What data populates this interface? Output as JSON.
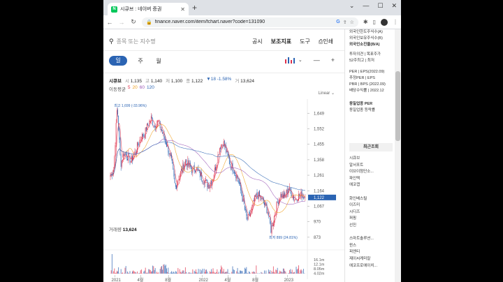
{
  "browser": {
    "tab_title": "시큐브 : 네이버 증권",
    "favicon_letter": "N",
    "url": "finance.naver.com/item/fchart.naver?code=131090"
  },
  "search": {
    "placeholder": "종목 또는 지수명"
  },
  "top_menu": [
    "공시",
    "보조지표",
    "도구",
    "인쇄"
  ],
  "top_menu_selected": "보조지표",
  "periods": [
    "일",
    "주",
    "월"
  ],
  "period_active": "일",
  "quote": {
    "name": "시큐브",
    "open_label": "시",
    "open": "1,135",
    "high_label": "고",
    "high": "1,140",
    "low_label": "저",
    "low": "1,100",
    "close_label": "종",
    "close": "1,122",
    "change": "▼18 -1.58%",
    "volume_label": "거",
    "volume": "13,624"
  },
  "moving_average": {
    "label": "이동평균",
    "periods": [
      "5",
      "20",
      "60",
      "120"
    ],
    "colors": [
      "#e0314b",
      "#f1a01f",
      "#9b59b6",
      "#2b64b3"
    ]
  },
  "scale_mode": "Linear",
  "colors": {
    "up": "#e0314b",
    "down": "#2b64b3",
    "accent": "#2b64b3",
    "current_tag": "#2b64b3"
  },
  "side_panel": {
    "investor_items": [
      "외국인한도주식수(A)",
      "외국인보유주식수(B)",
      "외국인소진율(B/A)"
    ],
    "opinion_items": [
      "투자의견 | 목표주가",
      "52주최고 | 최저"
    ],
    "valuation_items": [
      "PER | EPS(2022.09)",
      "추정PER | EPS",
      "PBR | BPS (2022.09)",
      "배당수익률 | 2022.12"
    ],
    "industry_items": [
      "동일업종 PER",
      "동일업종 등락률"
    ],
    "recent_title": "최근조회",
    "recent_items": [
      "시큐브",
      "알서포트",
      "이브이첨단소...",
      "파인텍",
      "에코캡",
      "",
      "화인베스틸",
      "이즈미",
      "시디즈",
      "퍼핑",
      "선진",
      "",
      "스마트솔루션...",
      "윈스",
      "피엔티",
      "제이씨케미칼",
      "에코프로에이치..."
    ]
  },
  "chart_data": {
    "type": "candlestick",
    "title": "",
    "x_tick_labels": [
      "2021",
      "4월",
      "8월",
      "2022",
      "4월",
      "8월",
      "2023"
    ],
    "y_tick_labels": [
      "1,649",
      "1,552",
      "1,455",
      "1,358",
      "1,261",
      "1,164",
      "1,067",
      "970",
      "873"
    ],
    "ylim": [
      820,
      1720
    ],
    "current_price": "1,122",
    "annotations": {
      "high": "최고 1,699 (-33.96%)",
      "low": "최저 899 (24.81%)"
    },
    "volume_title": "거래량",
    "volume_value": "13,624",
    "volume_ticks": [
      "16.1m",
      "12.1m",
      "8.05m",
      "4.02m"
    ],
    "closes_approx": [
      1260,
      1300,
      1700,
      1330,
      1400,
      1380,
      1350,
      1390,
      1450,
      1500,
      1520,
      1580,
      1620,
      1560,
      1600,
      1540,
      1480,
      1420,
      1330,
      1180,
      1250,
      1300,
      1350,
      1320,
      1290,
      1310,
      1270,
      1240,
      1210,
      1200,
      1250,
      1330,
      1440,
      1470,
      1400,
      1330,
      1300,
      1260,
      1180,
      1080,
      980,
      1020,
      1100,
      1140,
      1120,
      1080,
      1040,
      920,
      1010,
      1100,
      1140,
      1120,
      1180,
      1150,
      1110,
      1130,
      1140,
      1122
    ]
  }
}
